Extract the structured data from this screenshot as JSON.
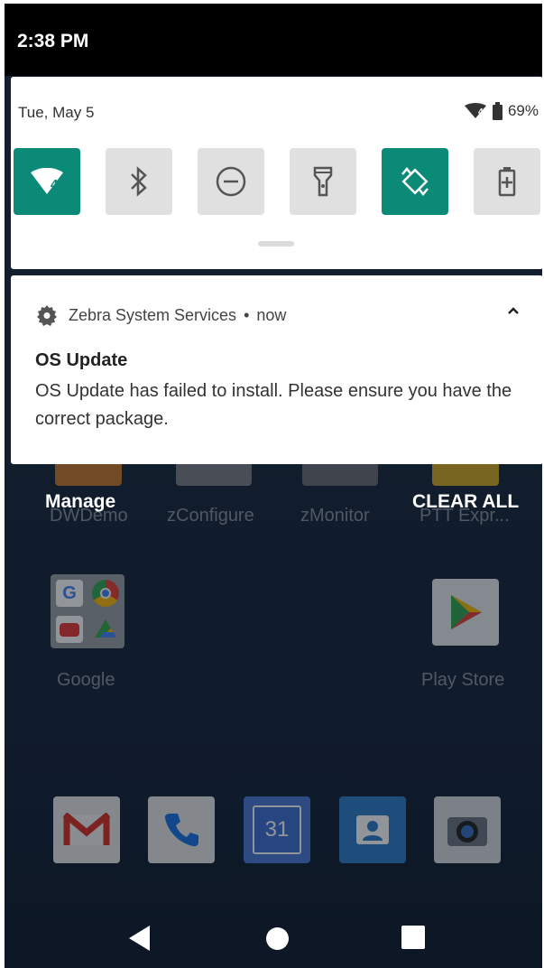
{
  "status_bar": {
    "time": "2:38 PM"
  },
  "quick_settings": {
    "date": "Tue, May 5",
    "battery_percent": "69%",
    "wifi_badge": "4",
    "tiles": [
      {
        "name": "wifi",
        "active": true
      },
      {
        "name": "bluetooth",
        "active": false
      },
      {
        "name": "do-not-disturb",
        "active": false
      },
      {
        "name": "flashlight",
        "active": false
      },
      {
        "name": "auto-rotate",
        "active": true
      },
      {
        "name": "battery-saver",
        "active": false
      }
    ]
  },
  "notification": {
    "app": "Zebra System Services",
    "separator": "•",
    "time": "now",
    "title": "OS Update",
    "body": "OS Update has failed to install. Please ensure you have the correct package."
  },
  "actions": {
    "manage": "Manage",
    "clear_all": "CLEAR ALL"
  },
  "home": {
    "row1_labels": [
      "DWDemo",
      "zConfigure",
      "zMonitor",
      "PTT Expr..."
    ],
    "apps": [
      {
        "label": "Google"
      },
      {
        "label": "Play Store"
      }
    ],
    "dock_date": "31"
  },
  "colors": {
    "accent": "#0b8a78",
    "tile_off": "#e0e0e0"
  }
}
